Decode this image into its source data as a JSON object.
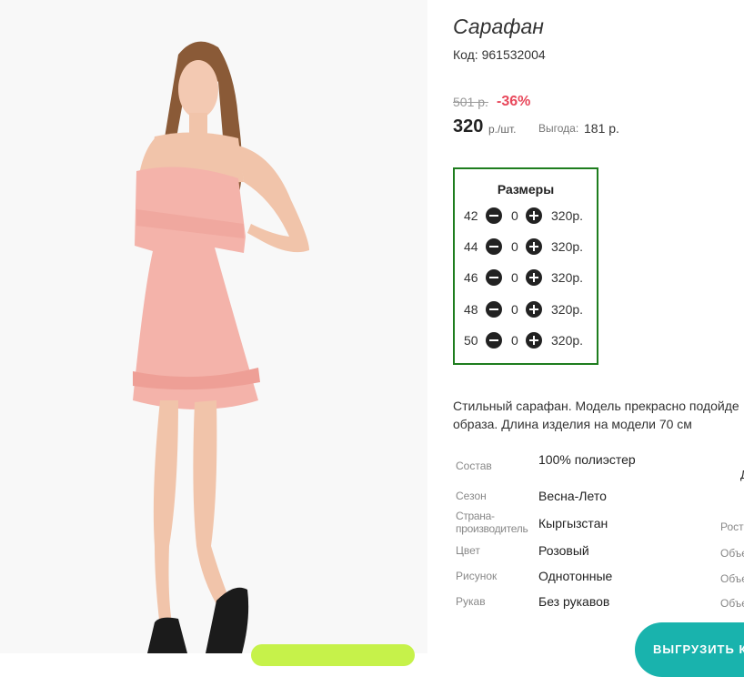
{
  "product": {
    "title": "Сарафан",
    "code_label": "Код:",
    "code": "961532004",
    "old_price": "501 р.",
    "discount": "-36%",
    "price": "320",
    "price_unit": "р./шт.",
    "benefit_label": "Выгода:",
    "benefit_value": "181 р."
  },
  "sizes": {
    "title": "Размеры",
    "rows": [
      {
        "size": "42",
        "qty": "0",
        "price": "320р."
      },
      {
        "size": "44",
        "qty": "0",
        "price": "320р."
      },
      {
        "size": "46",
        "qty": "0",
        "price": "320р."
      },
      {
        "size": "48",
        "qty": "0",
        "price": "320р."
      },
      {
        "size": "50",
        "qty": "0",
        "price": "320р."
      }
    ]
  },
  "description": {
    "line1": "Стильный сарафан. Модель прекрасно подойде",
    "line2": "образа. Длина изделия на модели 70 см"
  },
  "properties": [
    {
      "label": "Состав",
      "value": "100% полиэстер"
    },
    {
      "label": "Сезон",
      "value": "Весна-Лето"
    },
    {
      "label": "Страна-производитель",
      "value": "Кыргызстан"
    },
    {
      "label": "Цвет",
      "value": "Розовый"
    },
    {
      "label": "Рисунок",
      "value": "Однотонные"
    },
    {
      "label": "Рукав",
      "value": "Без рукавов"
    }
  ],
  "truncated_right": {
    "a": "Д",
    "rost": "Рост",
    "obe1": "Объе",
    "obe2": "Объе",
    "obe3": "Объе"
  },
  "buttons": {
    "export_label": "ВЫГРУЗИТЬ К"
  },
  "colors": {
    "discount": "#e8485b",
    "sizes_border": "#1e7d1e",
    "green_button": "#c6f24a",
    "teal_button": "#19b3ad"
  }
}
